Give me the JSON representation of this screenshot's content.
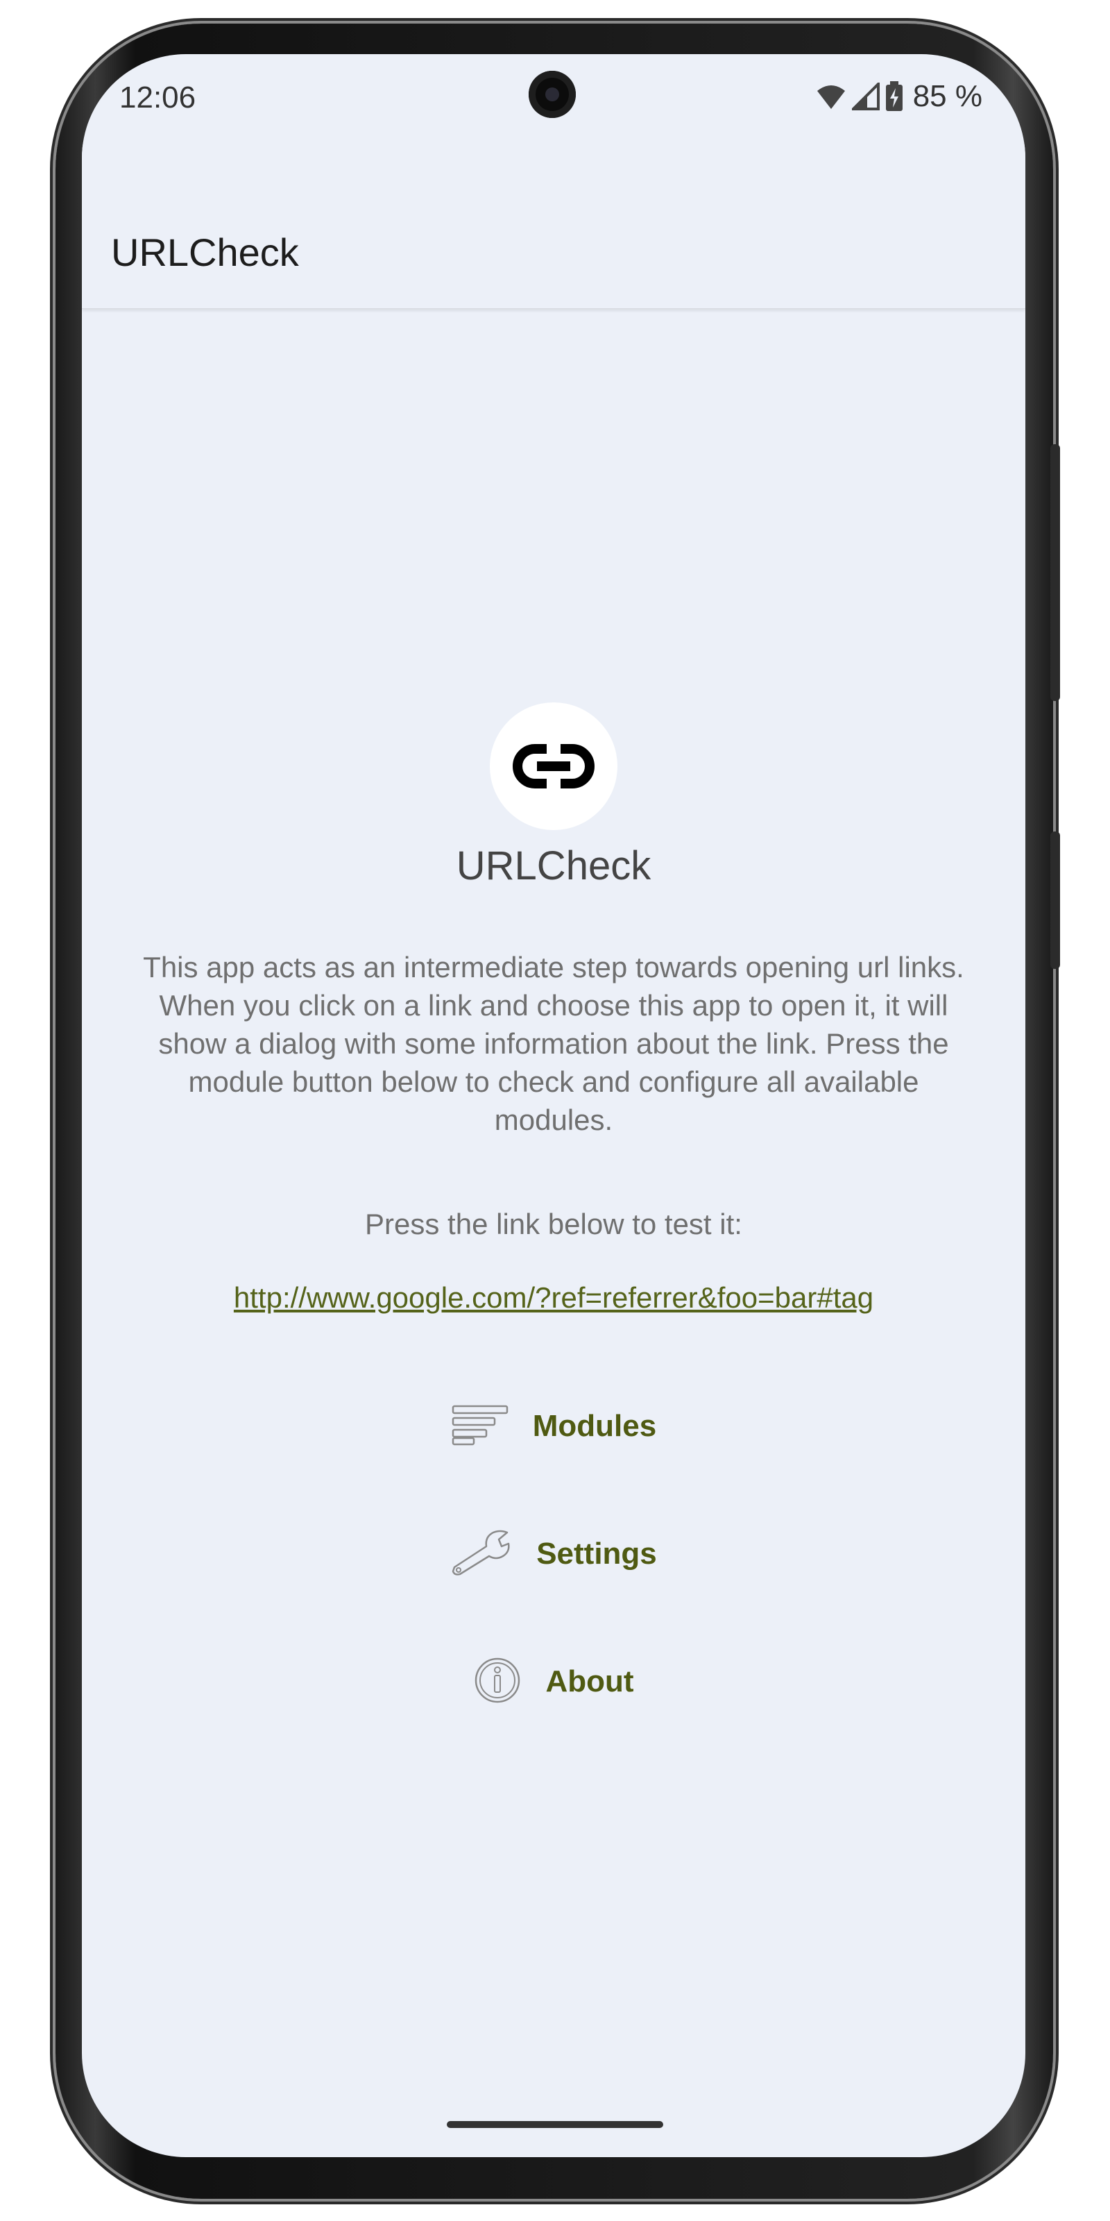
{
  "status_bar": {
    "time": "12:06",
    "battery": "85 %",
    "icons": [
      "wifi-icon",
      "cellular-signal-icon",
      "battery-charging-icon"
    ]
  },
  "app_bar": {
    "title": "URLCheck"
  },
  "main": {
    "logo_icon": "link-icon",
    "app_name": "URLCheck",
    "description": "This app acts as an intermediate step towards opening url links. When you click on a link and choose this app to open it, it will show a dialog with some information about the link. Press the module button below to check and configure all available modules.",
    "test_prompt": "Press the link below to test it:",
    "test_link": "http://www.google.com/?ref=referrer&foo=bar#tag",
    "buttons": [
      {
        "label": "Modules",
        "icon": "modules-icon"
      },
      {
        "label": "Settings",
        "icon": "wrench-icon"
      },
      {
        "label": "About",
        "icon": "info-icon"
      }
    ]
  },
  "colors": {
    "background": "#ecf0f8",
    "accent": "#4f5a12",
    "text_secondary": "#6f6f6f"
  }
}
